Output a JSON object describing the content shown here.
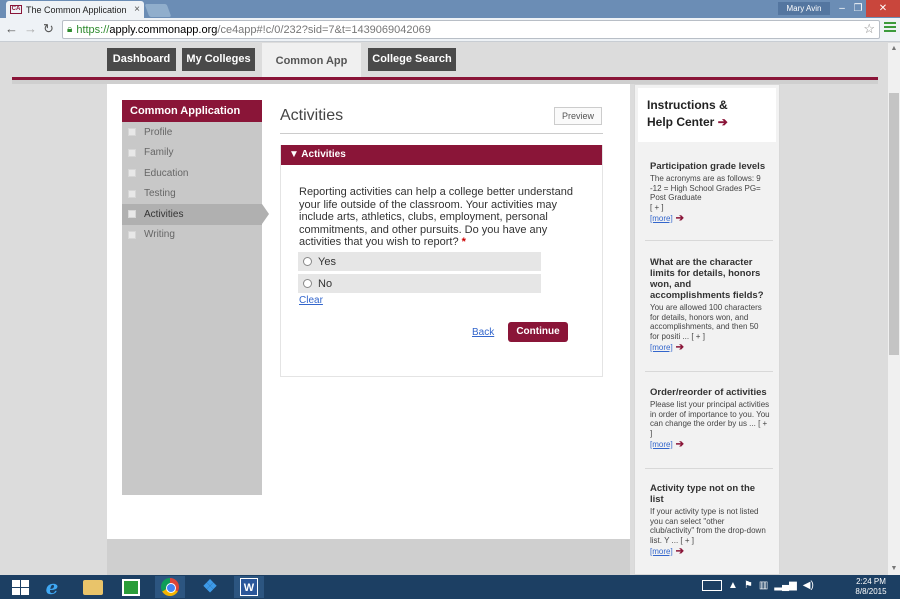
{
  "browser": {
    "tab_title": "The Common Application",
    "tab_favicon": "CA",
    "tab_close": "×",
    "user_name": "Mary Avin",
    "url_scheme": "https://",
    "url_host": "apply.commonapp.org",
    "url_path": "/ce4app#!c/0/232?sid=7&t=1439069042069"
  },
  "topnav": {
    "items": [
      "Dashboard",
      "My Colleges",
      "Common App",
      "College Search"
    ],
    "active": "Common App"
  },
  "sidenav": {
    "header": "Common Application",
    "items": [
      "Profile",
      "Family",
      "Education",
      "Testing",
      "Activities",
      "Writing"
    ],
    "active": "Activities"
  },
  "main": {
    "section_title": "Activities",
    "preview_label": "Preview",
    "panel_header": "▼ Activities",
    "question": "Reporting activities can help a college better understand your life outside of the classroom. Your activities may include arts, athletics, clubs, employment, personal commitments, and other pursuits. Do you have any activities that you wish to report?",
    "required_mark": "*",
    "options": [
      "Yes",
      "No"
    ],
    "clear_label": "Clear",
    "back_label": "Back",
    "continue_label": "Continue"
  },
  "help": {
    "title_line1": "Instructions &",
    "title_line2": "Help Center",
    "arrow": "➔",
    "more_label": "[more]",
    "items": [
      {
        "question": "Participation grade levels",
        "answer": "The acronyms are as follows: 9 -12 = High School Grades PG= Post Graduate",
        "expand": "[ + ]"
      },
      {
        "question": "What are the character limits for details, honors won, and accomplishments fields?",
        "answer": "You are allowed 100 characters for details, honors won, and accomplishments, and then 50 for positi ... [ + ]",
        "expand": ""
      },
      {
        "question": "Order/reorder of activities",
        "answer": "Please list your principal activities in order of importance to you. You can change the order by us ... [ + ]",
        "expand": ""
      },
      {
        "question": "Activity type not on the list",
        "answer": "If your activity type is not listed you can select \"other club/activity\" from the drop-down list. Y ... [ + ]",
        "expand": ""
      }
    ]
  },
  "taskbar": {
    "time": "2:24 PM",
    "date": "8/8/2015"
  }
}
